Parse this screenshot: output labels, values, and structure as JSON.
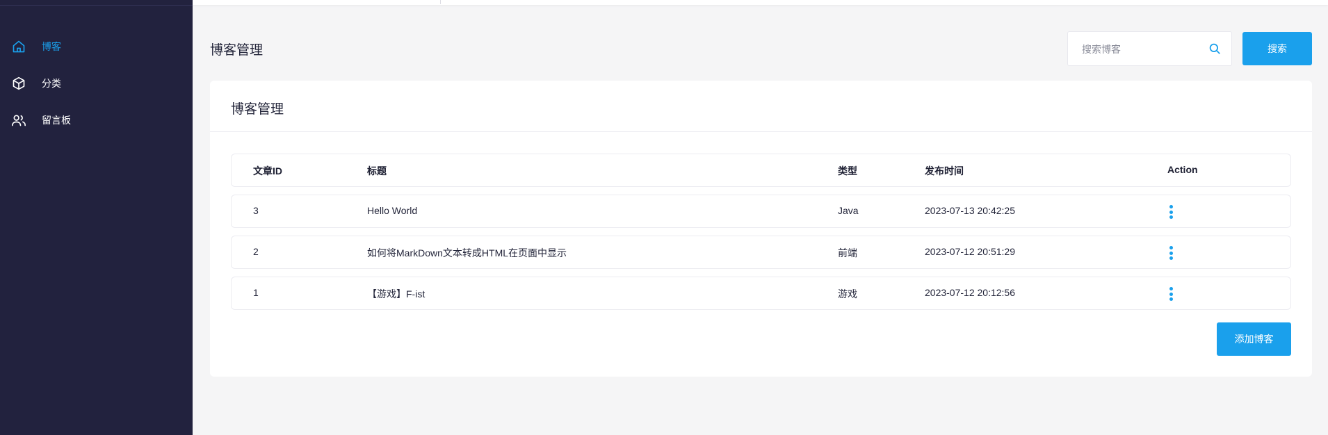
{
  "sidebar": {
    "items": [
      {
        "label": "博客",
        "icon": "home-icon",
        "active": true
      },
      {
        "label": "分类",
        "icon": "box-icon",
        "active": false
      },
      {
        "label": "留言板",
        "icon": "users-icon",
        "active": false
      }
    ]
  },
  "header": {
    "title": "博客管理",
    "search_placeholder": "搜索博客",
    "search_button": "搜索"
  },
  "card": {
    "title": "博客管理",
    "columns": [
      "文章ID",
      "标题",
      "类型",
      "发布时间",
      "Action"
    ],
    "rows": [
      {
        "id": "3",
        "title": "Hello World",
        "type": "Java",
        "time": "2023-07-13 20:42:25"
      },
      {
        "id": "2",
        "title": "如何将MarkDown文本转成HTML在页面中显示",
        "type": "前端",
        "time": "2023-07-12 20:51:29"
      },
      {
        "id": "1",
        "title": "【游戏】F-ist",
        "type": "游戏",
        "time": "2023-07-12 20:12:56"
      }
    ],
    "add_button": "添加博客"
  },
  "colors": {
    "accent": "#1aa0ec",
    "sidebar_bg": "#22223e",
    "page_bg": "#f5f5f6"
  }
}
